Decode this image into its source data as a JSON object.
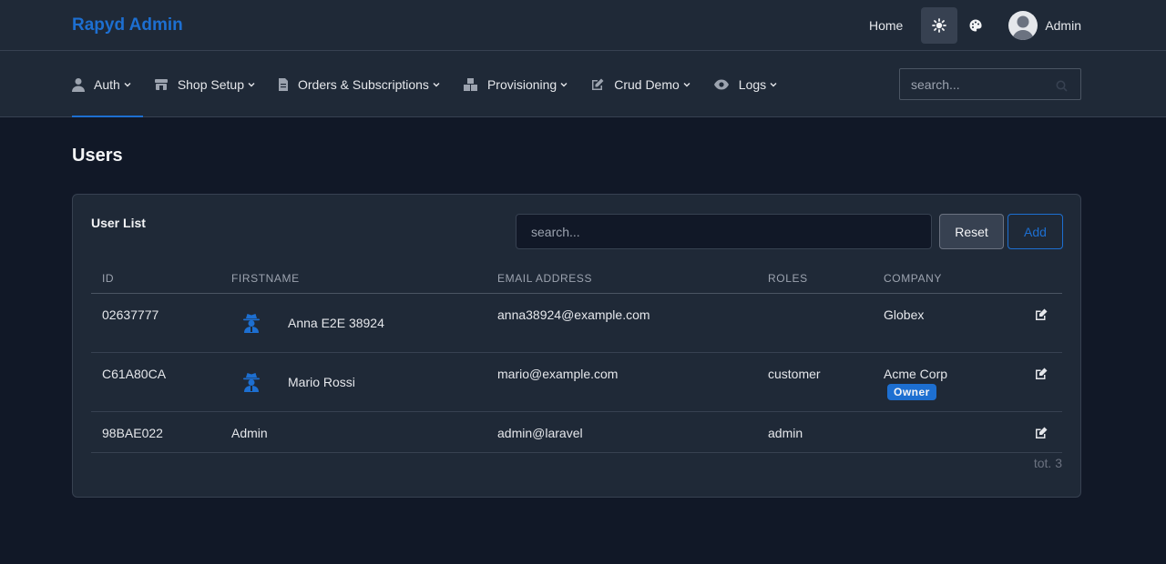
{
  "app": {
    "brand": "Rapyd Admin"
  },
  "topbar": {
    "home_label": "Home",
    "user_name": "Admin"
  },
  "nav": {
    "items": [
      {
        "label": "Auth",
        "icon": "user-icon"
      },
      {
        "label": "Shop Setup",
        "icon": "store-icon"
      },
      {
        "label": "Orders & Subscriptions",
        "icon": "file-icon"
      },
      {
        "label": "Provisioning",
        "icon": "cubes-icon"
      },
      {
        "label": "Crud Demo",
        "icon": "edit-icon"
      },
      {
        "label": "Logs",
        "icon": "eye-icon"
      }
    ],
    "search_placeholder": "search..."
  },
  "page": {
    "title": "Users"
  },
  "card": {
    "title": "User List",
    "search_placeholder": "search...",
    "reset_label": "Reset",
    "add_label": "Add",
    "columns": [
      "ID",
      "FIRSTNAME",
      "EMAIL ADDRESS",
      "ROLES",
      "COMPANY"
    ],
    "rows": [
      {
        "id": "02637777",
        "firstname": "Anna E2E 38924",
        "impersonate_icon": true,
        "email": "anna38924@example.com",
        "roles": "",
        "company": "Globex",
        "badge": ""
      },
      {
        "id": "C61A80CA",
        "firstname": "Mario Rossi",
        "impersonate_icon": true,
        "email": "mario@example.com",
        "roles": "customer",
        "company": "Acme Corp",
        "badge": "Owner"
      },
      {
        "id": "98BAE022",
        "firstname": "Admin",
        "impersonate_icon": false,
        "email": "admin@laravel",
        "roles": "admin",
        "company": "",
        "badge": ""
      }
    ],
    "total": "tot. 3"
  },
  "colors": {
    "accent": "#1d6fd1",
    "background": "#111827",
    "surface": "#1f2937"
  }
}
